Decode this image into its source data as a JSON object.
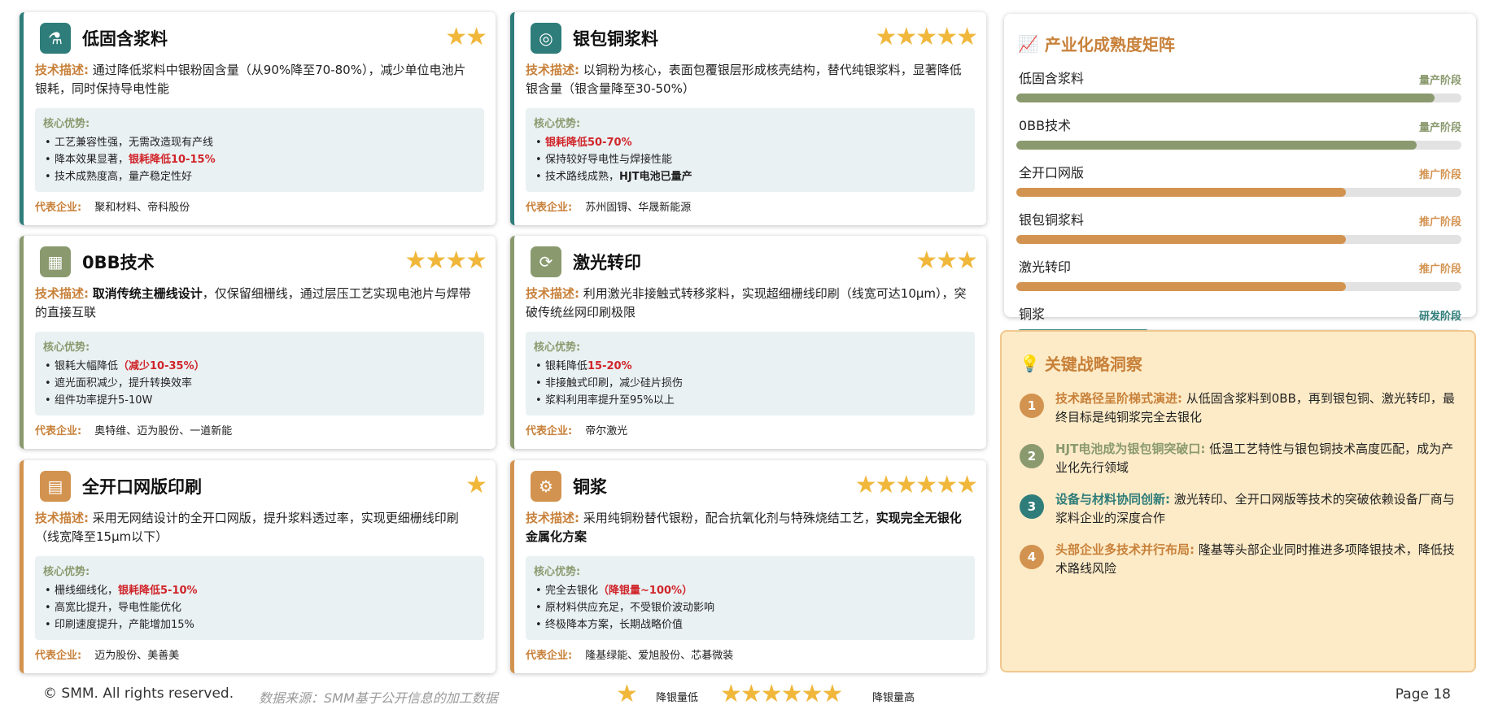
{
  "cards": [
    {
      "title": "低固含浆料",
      "stars": "★★",
      "desc_label": "技术描述:",
      "desc_text": "通过降低浆料中银粉固含量（从90%降至70-80%），减少单位电池片银耗，同时保持导电性能",
      "adv_label": "核心优势:",
      "adv": [
        "工艺兼容性强，无需改造现有产线",
        "降本效果显著，",
        "技术成熟度高，量产稳定性好"
      ],
      "adv_hl": "银耗降低10-15%",
      "ent_label": "代表企业:",
      "ent": "聚和材料、帝科股份"
    },
    {
      "title": "银包铜浆料",
      "stars": "★★★★★",
      "desc_label": "技术描述:",
      "desc_text": "以铜粉为核心，表面包覆银层形成核壳结构，替代纯银浆料，显著降低银含量（银含量降至30-50%）",
      "adv_label": "核心优势:",
      "adv_hl": "银耗降低50-70%",
      "adv": [
        "保持较好导电性与焊接性能",
        "技术路线成熟，"
      ],
      "adv_bold": "HJT电池已量产",
      "ent_label": "代表企业:",
      "ent": "苏州固锝、华晟新能源"
    },
    {
      "title": "0BB技术",
      "stars": "★★★★",
      "desc_label": "技术描述:",
      "desc_bold": "取消传统主栅线设计",
      "desc_text": "，仅保留细栅线，通过层压工艺实现电池片与焊带的直接互联",
      "adv_label": "核心优势:",
      "adv": [
        "银耗大幅降低",
        "遮光面积减少，提升转换效率",
        "组件功率提升5-10W"
      ],
      "adv_hl": "（减少10-35%）",
      "ent_label": "代表企业:",
      "ent": "奥特维、迈为股份、一道新能"
    },
    {
      "title": "激光转印",
      "stars": "★★★",
      "desc_label": "技术描述:",
      "desc_text": "利用激光非接触式转移浆料，实现超细栅线印刷（线宽可达10μm），突破传统丝网印刷极限",
      "adv_label": "核心优势:",
      "adv": [
        "银耗降低",
        "非接触式印刷，减少硅片损伤",
        "浆料利用率提升至95%以上"
      ],
      "adv_hl": "15-20%",
      "ent_label": "代表企业:",
      "ent": "帝尔激光"
    },
    {
      "title": "全开口网版印刷",
      "stars": "★",
      "desc_label": "技术描述:",
      "desc_text": "采用无网结设计的全开口网版，提升浆料透过率，实现更细栅线印刷（线宽降至15μm以下）",
      "adv_label": "核心优势:",
      "adv": [
        "栅线细线化，",
        "高宽比提升，导电性能优化",
        "印刷速度提升，产能增加15%"
      ],
      "adv_hl": "银耗降低5-10%",
      "ent_label": "代表企业:",
      "ent": "迈为股份、美善美"
    },
    {
      "title": "铜浆",
      "stars": "★★★★★★",
      "desc_label": "技术描述:",
      "desc_text": "采用纯铜粉替代银粉，配合抗氧化剂与特殊烧结工艺，",
      "desc_bold": "实现完全无银化金属化方案",
      "adv_label": "核心优势:",
      "adv": [
        "完全去银化",
        "原材料供应充足，不受银价波动影响",
        "终极降本方案，长期战略价值"
      ],
      "adv_hl": "（降银量~100%）",
      "ent_label": "代表企业:",
      "ent": "隆基绿能、爱旭股份、芯碁微装"
    }
  ],
  "matrix": {
    "title": "产业化成熟度矩阵",
    "rows": [
      {
        "name": "低固含浆料",
        "stage": "量产阶段",
        "level": 0.94,
        "color": "#8a9a6e"
      },
      {
        "name": "0BB技术",
        "stage": "量产阶段",
        "level": 0.9,
        "color": "#8a9a6e"
      },
      {
        "name": "全开口网版",
        "stage": "推广阶段",
        "level": 0.74,
        "color": "#d39350"
      },
      {
        "name": "银包铜浆料",
        "stage": "推广阶段",
        "level": 0.74,
        "color": "#d39350"
      },
      {
        "name": "激光转印",
        "stage": "推广阶段",
        "level": 0.74,
        "color": "#d39350"
      },
      {
        "name": "铜浆",
        "stage": "研发阶段",
        "level": 0.3,
        "color": "#2e7d7a"
      }
    ]
  },
  "insights": {
    "title": "关键战略洞察",
    "items": [
      {
        "num": "1",
        "color": "#d39350",
        "hl_color": "#c8813a",
        "hl": "技术路径呈阶梯式演进:",
        "text": " 从低固含浆料到0BB，再到银包铜、激光转印，最终目标是纯铜浆完全去银化"
      },
      {
        "num": "2",
        "color": "#8a9a6e",
        "hl_color": "#8a9a6e",
        "hl": "HJT电池成为银包铜突破口:",
        "text": " 低温工艺特性与银包铜技术高度匹配，成为产业化先行领域"
      },
      {
        "num": "3",
        "color": "#2e7d7a",
        "hl_color": "#2e7d7a",
        "hl": "设备与材料协同创新:",
        "text": " 激光转印、全开口网版等技术的突破依赖设备厂商与浆料企业的深度合作"
      },
      {
        "num": "4",
        "color": "#d39350",
        "hl_color": "#c8813a",
        "hl": "头部企业多技术并行布局:",
        "text": " 隆基等头部企业同时推进多项降银技术，降低技术路线风险"
      }
    ]
  },
  "footer": {
    "copyright": "© SMM. All rights reserved.",
    "source": "数据来源：SMM基于公开信息的加工数据",
    "legend_low_stars": "★",
    "legend_low": "降银量低",
    "legend_high_stars": "★★★★★★",
    "legend_high": "降银量高",
    "page": "Page 18"
  }
}
